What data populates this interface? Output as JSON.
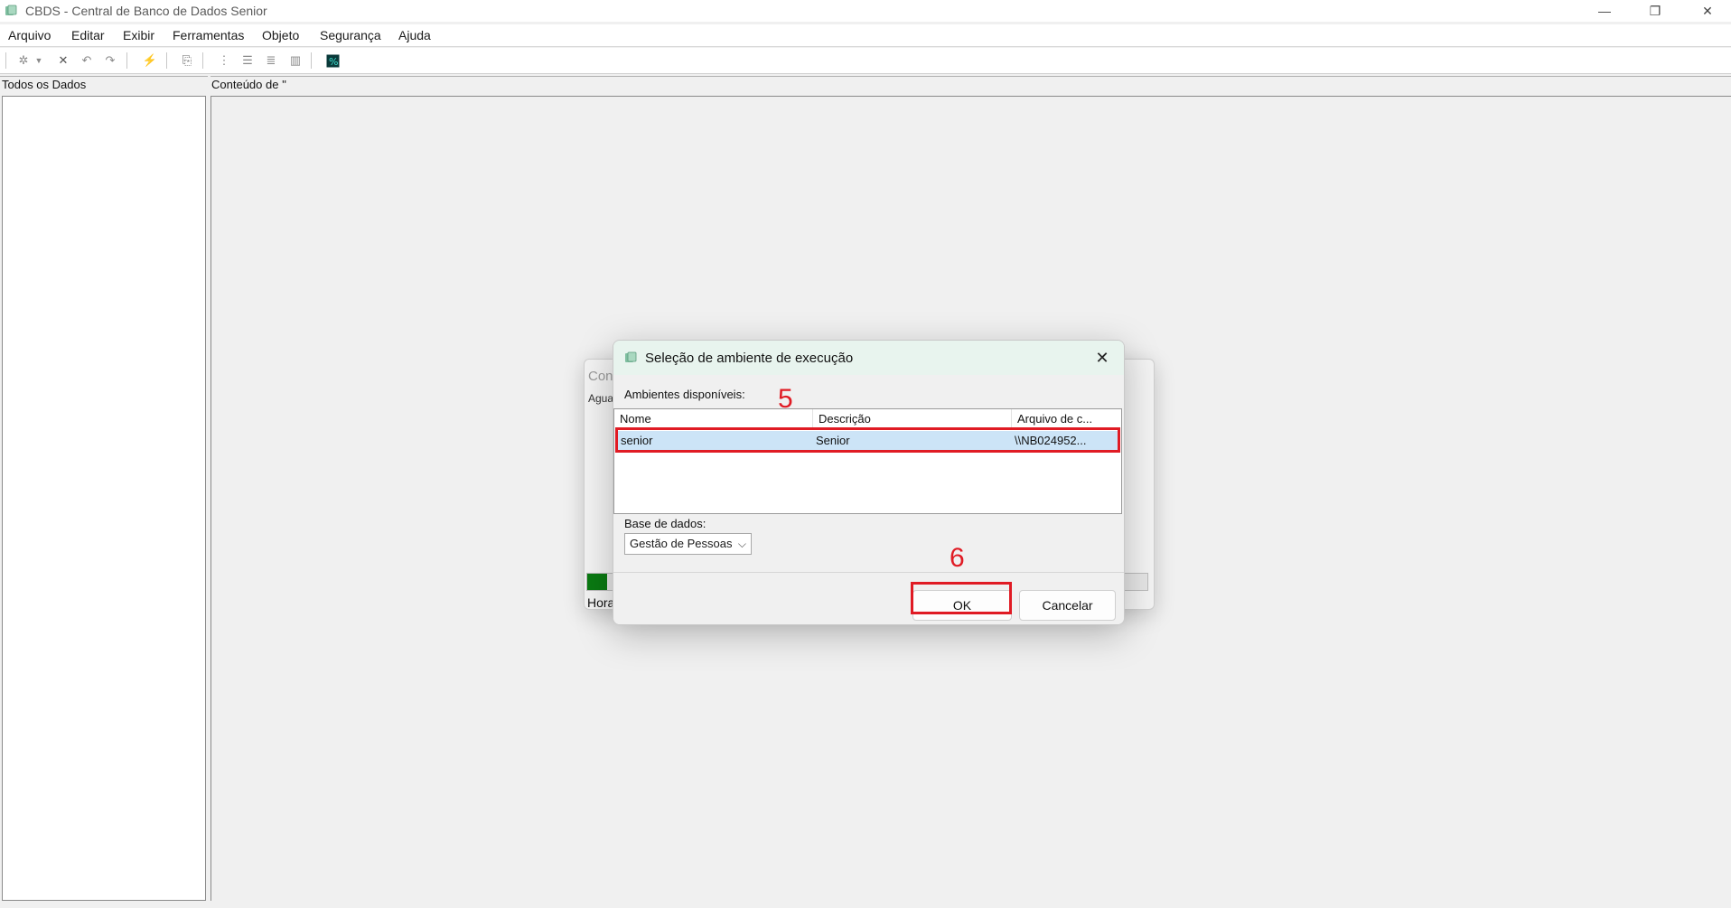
{
  "window": {
    "title": "CBDS - Central de Banco de Dados Senior",
    "icon": "database-icon",
    "controls": {
      "minimize": "—",
      "restore": "❐",
      "close": "✕"
    }
  },
  "menu": [
    "Arquivo",
    "Editar",
    "Exibir",
    "Ferramentas",
    "Objeto",
    "Segurança",
    "Ajuda"
  ],
  "toolbar": {
    "icons": [
      "new-icon",
      "dropdown-icon",
      "delete-icon",
      "undo-icon",
      "redo-icon",
      "run-icon",
      "paste-icon",
      "tree-icon",
      "indent-icon",
      "list-icon",
      "grid-icon",
      "query-icon"
    ]
  },
  "panels": {
    "left_header": "Todos os Dados",
    "right_header": "Conteúdo de ''"
  },
  "background_dialog": {
    "title": "Con",
    "label": "Agua",
    "hora": "Hora",
    "progress_fraction": 0.035,
    "progress_color": "#0a7a12"
  },
  "dialog": {
    "title": "Seleção de ambiente de execução",
    "ambientes_label": "Ambientes disponíveis:",
    "columns": [
      "Nome",
      "Descrição",
      "Arquivo de c..."
    ],
    "rows": [
      {
        "nome": "senior",
        "descricao": "Senior",
        "arquivo": "\\\\NB024952..."
      }
    ],
    "base_label": "Base de dados:",
    "base_value": "Gestão de Pessoas",
    "ok_label": "OK",
    "cancel_label": "Cancelar"
  },
  "annotations": {
    "step_row": "5",
    "step_ok": "6",
    "color": "#e01b24"
  }
}
